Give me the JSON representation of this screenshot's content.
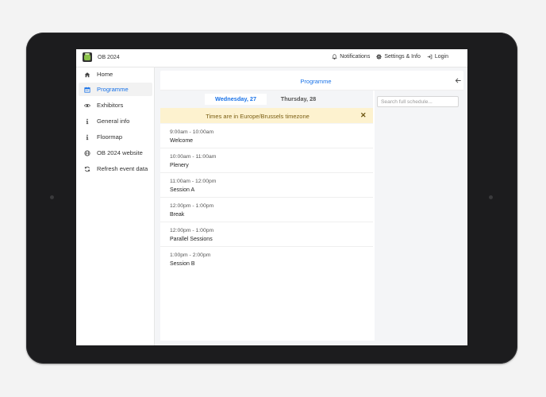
{
  "app": {
    "title": "OB 2024"
  },
  "topbar": {
    "notifications": "Notifications",
    "settings": "Settings & Info",
    "login": "Login"
  },
  "sidebar": {
    "items": [
      {
        "label": "Home",
        "icon": "home-icon"
      },
      {
        "label": "Programme",
        "icon": "calendar-icon",
        "active": true
      },
      {
        "label": "Exhibitors",
        "icon": "eye-icon"
      },
      {
        "label": "General info",
        "icon": "info-icon"
      },
      {
        "label": "Floormap",
        "icon": "info-icon"
      },
      {
        "label": "OB 2024 website",
        "icon": "globe-icon"
      },
      {
        "label": "Refresh event data",
        "icon": "refresh-icon"
      }
    ]
  },
  "main": {
    "title": "Programme",
    "tabs": [
      {
        "label": "Wednesday, 27",
        "active": true
      },
      {
        "label": "Thursday, 28",
        "active": false
      }
    ],
    "timezone_notice": "Times are in Europe/Brussels timezone",
    "sessions": [
      {
        "time": "9:00am - 10:00am",
        "name": "Welcome"
      },
      {
        "time": "10:00am - 11:00am",
        "name": "Plenery"
      },
      {
        "time": "11:00am - 12:00pm",
        "name": "Session A"
      },
      {
        "time": "12:00pm - 1:00pm",
        "name": "Break"
      },
      {
        "time": "12:00pm - 1:00pm",
        "name": "Parallel Sessions"
      },
      {
        "time": "1:00pm - 2:00pm",
        "name": "Session B"
      }
    ],
    "search": {
      "placeholder": "Search full schedule..."
    }
  },
  "colors": {
    "accent": "#1a73e8",
    "banner_bg": "#fdf2cf",
    "device_frame": "#1c1c1e"
  }
}
